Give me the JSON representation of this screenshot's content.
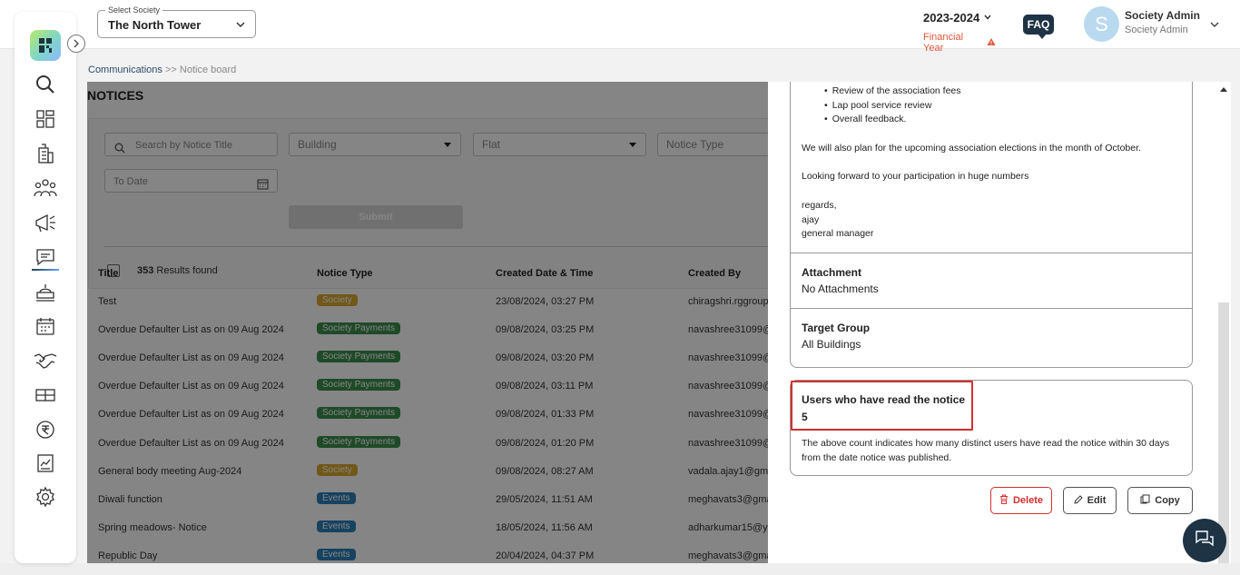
{
  "header": {
    "society_legend": "Select Society",
    "society_value": "The North Tower",
    "financial_year": "2023-2024",
    "financial_year_label": "Financial Year",
    "faq_label": "FAQ",
    "avatar_initial": "S",
    "user_name": "Society Admin",
    "user_role": "Society Admin"
  },
  "sidebar": {
    "items": [
      "search-icon",
      "dashboard-icon",
      "building-icon",
      "members-icon",
      "announcement-icon",
      "communications-icon",
      "facility-icon",
      "calendar-icon",
      "handshake-icon",
      "gate-icon",
      "payments-icon",
      "reports-icon",
      "settings-icon"
    ],
    "active_index": 5
  },
  "breadcrumb": {
    "parent": "Communications",
    "separator": ">>",
    "current": "Notice board"
  },
  "notices": {
    "title": "NOTICES",
    "search_placeholder": "Search by Notice Title",
    "building_placeholder": "Building",
    "flat_placeholder": "Flat",
    "notice_type_placeholder": "Notice Type",
    "to_date_placeholder": "To Date",
    "submit_label": "Submit",
    "results_count": "353",
    "results_label": "Results found",
    "columns": [
      "Title",
      "Notice Type",
      "Created Date & Time",
      "Created By"
    ],
    "rows": [
      {
        "title": "Test",
        "type": "Society",
        "type_color": "#d9a72f",
        "date": "23/08/2024, 03:27 PM",
        "by": "chiragshri.rggroup"
      },
      {
        "title": "Overdue Defaulter List as on 09 Aug 2024",
        "type": "Society Payments",
        "type_color": "#3c8e4e",
        "date": "09/08/2024, 03:25 PM",
        "by": "navashree31099@"
      },
      {
        "title": "Overdue Defaulter List as on 09 Aug 2024",
        "type": "Society Payments",
        "type_color": "#3c8e4e",
        "date": "09/08/2024, 03:20 PM",
        "by": "navashree31099@"
      },
      {
        "title": "Overdue Defaulter List as on 09 Aug 2024",
        "type": "Society Payments",
        "type_color": "#3c8e4e",
        "date": "09/08/2024, 03:11 PM",
        "by": "navashree31099@"
      },
      {
        "title": "Overdue Defaulter List as on 09 Aug 2024",
        "type": "Society Payments",
        "type_color": "#3c8e4e",
        "date": "09/08/2024, 01:33 PM",
        "by": "navashree31099@"
      },
      {
        "title": "Overdue Defaulter List as on 09 Aug 2024",
        "type": "Society Payments",
        "type_color": "#3c8e4e",
        "date": "09/08/2024, 01:20 PM",
        "by": "navashree31099@"
      },
      {
        "title": "General body meeting Aug-2024",
        "type": "Society",
        "type_color": "#d9a72f",
        "date": "09/08/2024, 08:27 AM",
        "by": "vadala.ajay1@gma"
      },
      {
        "title": "Diwali function",
        "type": "Events",
        "type_color": "#2c7fb8",
        "date": "29/05/2024, 11:51 AM",
        "by": "meghavats3@gma"
      },
      {
        "title": "Spring meadows- Notice",
        "type": "Events",
        "type_color": "#2c7fb8",
        "date": "18/05/2024, 11:56 AM",
        "by": "adharkumar15@ya"
      },
      {
        "title": "Republic Day",
        "type": "Events",
        "type_color": "#2c7fb8",
        "date": "20/04/2024, 04:37 PM",
        "by": "meghavats3@gma"
      }
    ]
  },
  "detail": {
    "bullets": [
      "Review of the association fees",
      "Lap pool service review",
      "Overall feedback."
    ],
    "para_elections": "We will also plan for the upcoming association elections in the month of October.",
    "para_participation": "Looking forward to your participation in huge numbers",
    "sign_regards": "regards,",
    "sign_name": "ajay",
    "sign_title": "general manager",
    "attachment_label": "Attachment",
    "attachment_value": "No Attachments",
    "target_label": "Target Group",
    "target_value": "All Buildings",
    "read_label": "Users who have read the notice",
    "read_count": "5",
    "read_note": "The above count indicates how many distinct users have read the notice within 30 days from the date notice was published.",
    "delete_label": "Delete",
    "edit_label": "Edit",
    "copy_label": "Copy"
  },
  "colors": {
    "accent_dark": "#1e3344",
    "highlight_red": "#d32f2f",
    "warning_orange": "#e0563a"
  }
}
